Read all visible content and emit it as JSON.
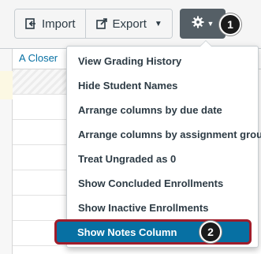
{
  "toolbar": {
    "import_label": "Import",
    "export_label": "Export",
    "export_caret": "▼",
    "gear_caret": "▼"
  },
  "grid": {
    "column_header": "A Closer"
  },
  "settings_menu": {
    "items": [
      {
        "label": "View Grading History"
      },
      {
        "label": "Hide Student Names"
      },
      {
        "label": "Arrange columns by due date"
      },
      {
        "label": "Arrange columns by assignment group"
      },
      {
        "label": "Treat Ungraded as 0"
      },
      {
        "label": "Show Concluded Enrollments"
      },
      {
        "label": "Show Inactive Enrollments"
      },
      {
        "label": "Show Notes Column"
      }
    ]
  },
  "callouts": {
    "step1": "1",
    "step2": "2"
  },
  "colors": {
    "accent": "#0770a3",
    "highlight_border": "#a01d2b",
    "gear_button": "#555f66"
  }
}
